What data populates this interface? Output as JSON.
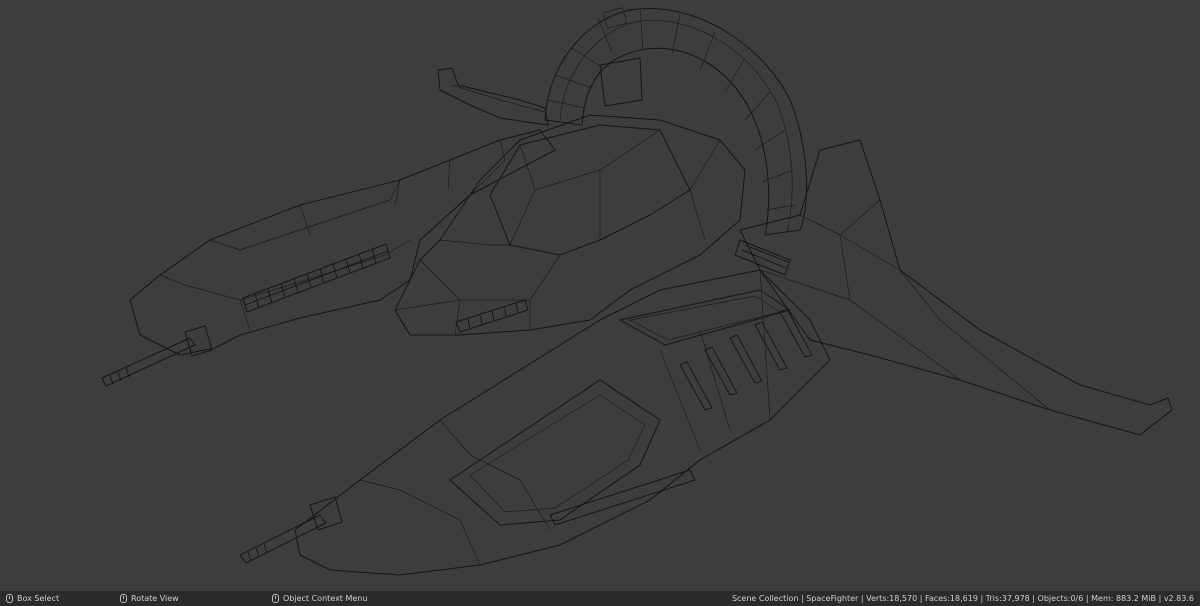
{
  "status_bar": {
    "hints": [
      {
        "icon": "mouse-left-icon",
        "label": "Box Select"
      },
      {
        "icon": "mouse-middle-icon",
        "label": "Rotate View"
      },
      {
        "icon": "mouse-right-icon",
        "label": "Object Context Menu"
      }
    ],
    "scene_stats": "Scene Collection | SpaceFighter | Verts:18,570 | Faces:18,619 | Tris:37,978 | Objects:0/6 | Mem: 883.2 MiB | v2.83.6"
  },
  "viewport": {
    "shading": "wireframe",
    "object": "SpaceFighter"
  },
  "colors": {
    "viewport_bg": "#3d3d3d",
    "wire": "#151515",
    "status_bg": "#2b2b2b",
    "status_text": "#d0d0d0"
  }
}
